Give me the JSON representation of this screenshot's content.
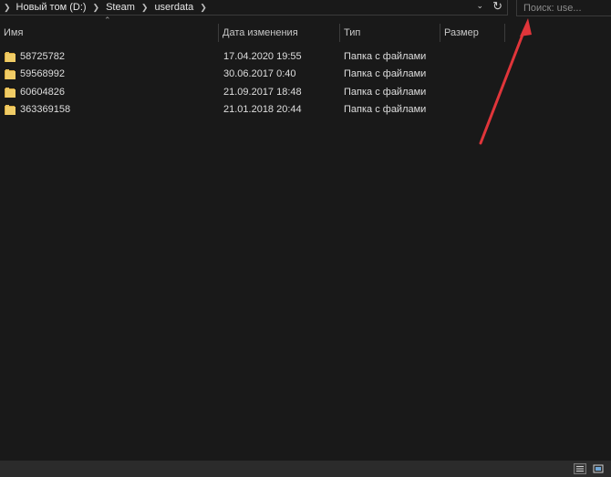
{
  "address_bar": {
    "breadcrumbs": [
      "Новый том (D:)",
      "Steam",
      "userdata"
    ]
  },
  "search": {
    "placeholder": "Поиск: use..."
  },
  "columns": {
    "name": "Имя",
    "date": "Дата изменения",
    "type": "Тип",
    "size": "Размер"
  },
  "rows": [
    {
      "name": "58725782",
      "date": "17.04.2020 19:55",
      "type": "Папка с файлами",
      "size": ""
    },
    {
      "name": "59568992",
      "date": "30.06.2017 0:40",
      "type": "Папка с файлами",
      "size": ""
    },
    {
      "name": "60604826",
      "date": "21.09.2017 18:48",
      "type": "Папка с файлами",
      "size": ""
    },
    {
      "name": "363369158",
      "date": "21.01.2018 20:44",
      "type": "Папка с файлами",
      "size": ""
    }
  ],
  "icons": {
    "folder": "folder-icon",
    "chevron": "chevron-right-icon",
    "refresh": "refresh-icon",
    "dropdown": "chevron-down-icon",
    "sort": "sort-ascending-icon",
    "details_view": "details-view-icon",
    "large_icons_view": "large-icons-view-icon"
  },
  "colors": {
    "background": "#191919",
    "folder": "#e8c15a",
    "annotation_arrow": "#e0353a"
  }
}
